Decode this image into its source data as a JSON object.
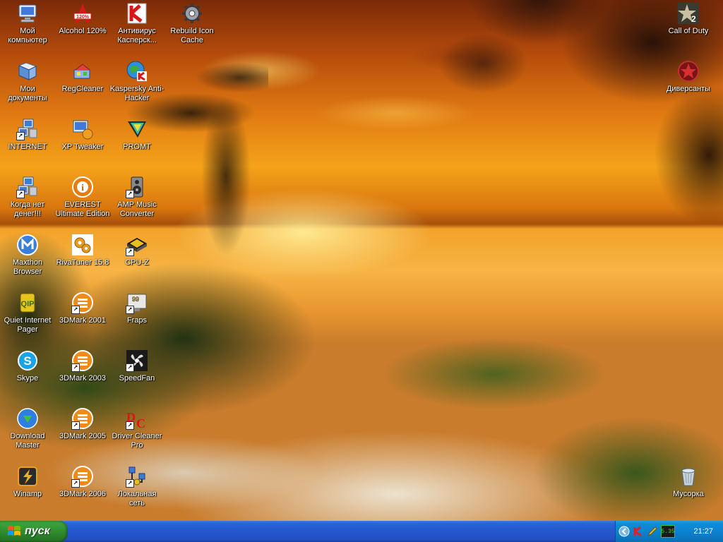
{
  "desktop": {
    "icons": [
      {
        "id": "my-computer",
        "label": "Мой компьютер",
        "icon": "computer-icon",
        "shortcut": false
      },
      {
        "id": "alcohol",
        "label": "Alcohol 120%",
        "icon": "alcohol-icon",
        "shortcut": false
      },
      {
        "id": "kaspersky-av",
        "label": "Антивирус Касперск...",
        "icon": "kaspersky-icon",
        "shortcut": false
      },
      {
        "id": "rebuild-icon-cache",
        "label": "Rebuild Icon Cache",
        "icon": "gear-icon",
        "shortcut": false
      },
      {
        "id": "my-documents",
        "label": "Мои документы",
        "icon": "documents-icon",
        "shortcut": false
      },
      {
        "id": "regcleaner",
        "label": "RegCleaner",
        "icon": "regcleaner-icon",
        "shortcut": false
      },
      {
        "id": "kaspersky-anti-hacker",
        "label": "Kaspersky Anti-Hacker",
        "icon": "kaspersky-globe-icon",
        "shortcut": false
      },
      {
        "id": "internet",
        "label": "INTERNET",
        "icon": "network-computer-icon",
        "shortcut": false
      },
      {
        "id": "xp-tweaker",
        "label": "XP Tweaker",
        "icon": "tweaker-icon",
        "shortcut": false
      },
      {
        "id": "promt",
        "label": "PROMT",
        "icon": "promt-icon",
        "shortcut": false
      },
      {
        "id": "kogda-net-deneg",
        "label": "Когда нет денег!!!",
        "icon": "network-computer-icon",
        "shortcut": false
      },
      {
        "id": "everest",
        "label": "EVEREST Ultimate Edition",
        "icon": "info-icon",
        "shortcut": false
      },
      {
        "id": "amp-music-converter",
        "label": "AMP Music Converter",
        "icon": "speaker-icon",
        "shortcut": false
      },
      {
        "id": "maxthon",
        "label": "Maxthon Browser",
        "icon": "maxthon-icon",
        "shortcut": false
      },
      {
        "id": "rivatuner",
        "label": "RivaTuner 15.8",
        "icon": "rivatuner-icon",
        "shortcut": false
      },
      {
        "id": "cpu-z",
        "label": "CPU-Z",
        "icon": "chip-icon",
        "shortcut": true
      },
      {
        "id": "quiet-internet-pager",
        "label": "Quiet Internet Pager",
        "icon": "qip-icon",
        "shortcut": false
      },
      {
        "id": "3dmark-2001",
        "label": "3DMark 2001",
        "icon": "3dmark-icon",
        "shortcut": true
      },
      {
        "id": "fraps",
        "label": "Fraps",
        "icon": "fraps-icon",
        "shortcut": true
      },
      {
        "id": "skype",
        "label": "Skype",
        "icon": "skype-icon",
        "shortcut": false
      },
      {
        "id": "3dmark-2003",
        "label": "3DMark 2003",
        "icon": "3dmark-icon",
        "shortcut": true
      },
      {
        "id": "speedfan",
        "label": "SpeedFan",
        "icon": "fan-icon",
        "shortcut": true
      },
      {
        "id": "download-master",
        "label": "Download Master",
        "icon": "download-icon",
        "shortcut": false
      },
      {
        "id": "3dmark-2005",
        "label": "3DMark 2005",
        "icon": "3dmark-icon",
        "shortcut": true
      },
      {
        "id": "driver-cleaner-pro",
        "label": "Driver Cleaner Pro",
        "icon": "driver-cleaner-icon",
        "shortcut": true
      },
      {
        "id": "winamp",
        "label": "Winamp",
        "icon": "winamp-icon",
        "shortcut": false
      },
      {
        "id": "3dmark-2006",
        "label": "3DMark 2006",
        "icon": "3dmark-icon",
        "shortcut": true
      },
      {
        "id": "local-network",
        "label": "Локальная сеть",
        "icon": "network-icon",
        "shortcut": true
      },
      {
        "id": "call-of-duty",
        "label": "Call of Duty",
        "icon": "cod-icon",
        "shortcut": false
      },
      {
        "id": "diversanty",
        "label": "Диверсанты",
        "icon": "star-emblem-icon",
        "shortcut": false
      },
      {
        "id": "recycle-bin",
        "label": "Мусорка",
        "icon": "recycle-bin-icon",
        "shortcut": false
      }
    ]
  },
  "taskbar": {
    "start_label": "пуск",
    "language": "RU",
    "clock": "21:27",
    "tray_icons": [
      "chevron-left-icon",
      "kaspersky-tray-icon",
      "pencil-tray-icon",
      "battery-monitor-icon"
    ],
    "battery_text": "5.35"
  },
  "colors": {
    "taskbar_blue": "#2557cd",
    "start_green": "#2d8b2d",
    "tray_blue": "#0c7fcc",
    "label_text": "#ffffff"
  }
}
